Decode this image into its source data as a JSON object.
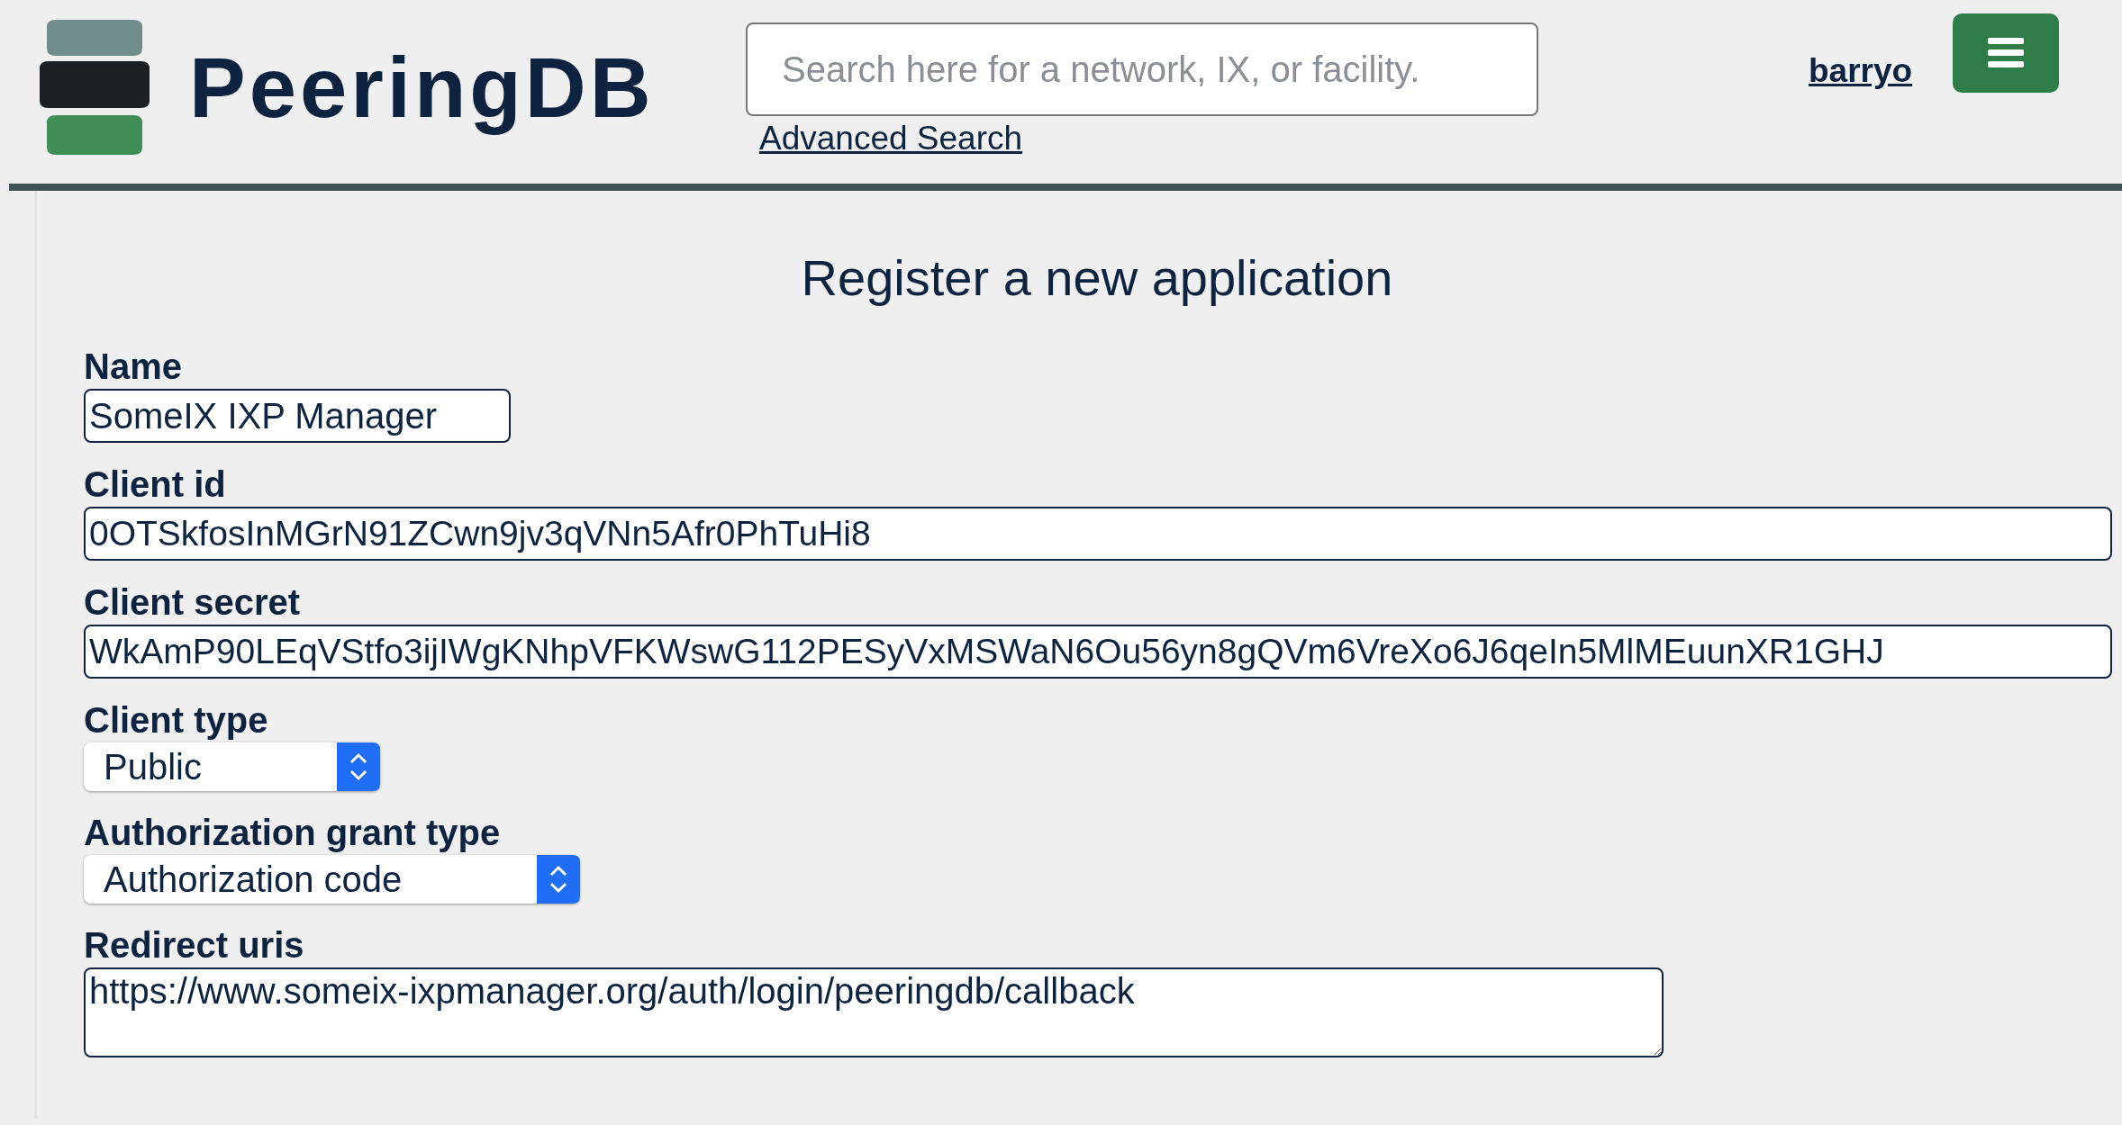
{
  "header": {
    "logo_text": "PeeringDB",
    "search": {
      "placeholder": "Search here for a network, IX, or facility."
    },
    "advanced_search": "Advanced Search",
    "user": "barryo"
  },
  "form": {
    "title": "Register a new application",
    "fields": [
      {
        "kind": "text",
        "label": "Name",
        "value": "SomeIX IXP Manager"
      },
      {
        "kind": "key",
        "label": "Client id",
        "value": "0OTSkfosInMGrN91ZCwn9jv3qVNn5Afr0PhTuHi8"
      },
      {
        "kind": "key",
        "label": "Client secret",
        "value": "WkAmP90LEqVStfo3ijIWgKNhpVFKWswG112PESyVxMSWaN6Ou56yn8gQVm6VreXo6J6qeIn5MlMEuunXR1GHJ"
      },
      {
        "kind": "select",
        "label": "Client type",
        "value": "Public"
      },
      {
        "kind": "select",
        "label": "Authorization grant type",
        "value": "Authorization code"
      },
      {
        "kind": "textarea",
        "label": "Redirect uris",
        "value": "https://www.someix-ixpmanager.org/auth/login/peeringdb/callback"
      }
    ]
  }
}
